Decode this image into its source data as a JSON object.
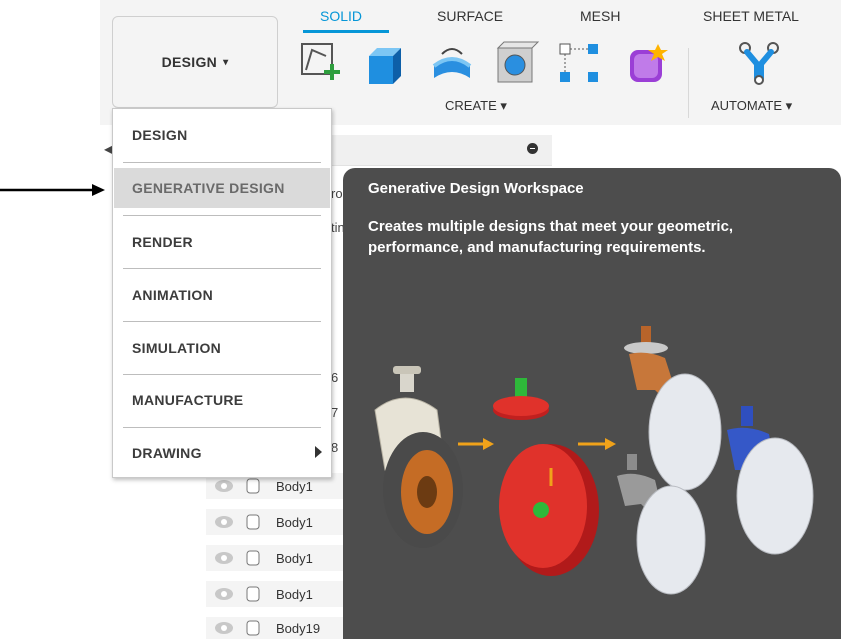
{
  "toolbar": {
    "workspace_button": "DESIGN",
    "workspace_caret": "▾",
    "tabs": [
      {
        "label": "SOLID",
        "active": true
      },
      {
        "label": "SURFACE",
        "active": false
      },
      {
        "label": "MESH",
        "active": false
      },
      {
        "label": "SHEET METAL",
        "active": false
      }
    ],
    "groups": [
      {
        "label": "CREATE ▾"
      },
      {
        "label": "AUTOMATE ▾"
      }
    ],
    "icons": [
      "create-sketch-icon",
      "extrude-icon",
      "revolve-icon",
      "hole-icon",
      "pattern-icon",
      "create-form-icon",
      "automate-icon"
    ],
    "accent_color": "#0696d7"
  },
  "workspace_menu": {
    "items": [
      {
        "label": "DESIGN",
        "highlighted": false
      },
      {
        "label": "GENERATIVE DESIGN",
        "highlighted": true
      },
      {
        "label": "RENDER",
        "highlighted": false
      },
      {
        "label": "ANIMATION",
        "highlighted": false
      },
      {
        "label": "SIMULATION",
        "highlighted": false
      },
      {
        "label": "MANUFACTURE",
        "highlighted": false
      },
      {
        "label": "DRAWING",
        "highlighted": false,
        "has_submenu": true
      }
    ]
  },
  "tooltip": {
    "title": "Generative Design Workspace",
    "description": "Creates multiple designs that meet your geometric, performance, and manufacturing requirements."
  },
  "browser": {
    "peek_fragments": [
      "ro",
      "tin",
      "6",
      "7",
      "8"
    ],
    "bodies": [
      "Body1",
      "Body1",
      "Body1",
      "Body1",
      "Body19"
    ]
  }
}
